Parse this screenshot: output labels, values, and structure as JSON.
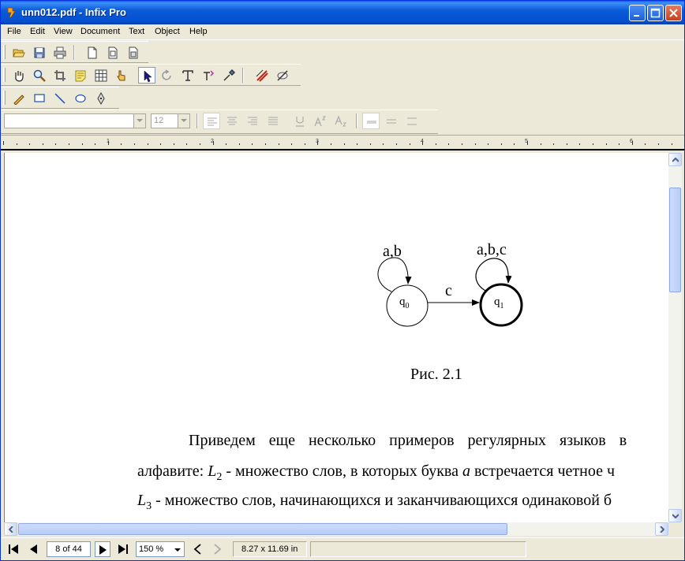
{
  "window": {
    "title": "unn012.pdf - Infix Pro",
    "accent": "#0450d0"
  },
  "menu": [
    "File",
    "Edit",
    "View",
    "Document",
    "Text",
    "Object",
    "Help"
  ],
  "toolbar_row1": [
    "open-icon",
    "save-icon",
    "print-icon",
    "new-page-icon",
    "page-icon",
    "page-copy-icon"
  ],
  "toolbar_row2": [
    "hand-icon",
    "zoom-icon",
    "crop-icon",
    "note-icon",
    "grid-icon",
    "pointer-finger-icon",
    "select-arrow-icon",
    "rotate-icon",
    "text-tool-icon",
    "text-flow-icon",
    "eyedropper-icon",
    "strike-icon",
    "hide-icon"
  ],
  "toolbar_row3": [
    "pencil-icon",
    "rectangle-icon",
    "line-icon",
    "ellipse-icon",
    "pen-nib-icon"
  ],
  "format": {
    "font_name": "",
    "font_size": "12"
  },
  "ruler": {
    "labels": [
      "1",
      "2",
      "3",
      "4",
      "5",
      "6"
    ]
  },
  "document": {
    "diagram": {
      "state0": "q",
      "state0_sub": "0",
      "state1": "q",
      "state1_sub": "1",
      "loop0_label": "a,b",
      "loop1_label": "a,b,c",
      "edge_label": "c",
      "caption": "Рис. 2.1"
    },
    "para_line1": "Приведем еще несколько примеров регулярных языков в",
    "para_line2_a": "алфавите: ",
    "para_line2_L": "L",
    "para_line2_sub": "2",
    "para_line2_b": " - множество слов, в которых буква ",
    "para_line2_a_it": "a",
    "para_line2_c": " встречается четное ч",
    "para_line3_L": "L",
    "para_line3_sub": "3",
    "para_line3_b": " - множество слов, начинающихся и заканчивающихся одинаковой б"
  },
  "status": {
    "page_field": "8 of 44",
    "zoom": "150 %",
    "page_size": "8.27 x 11.69 in"
  }
}
